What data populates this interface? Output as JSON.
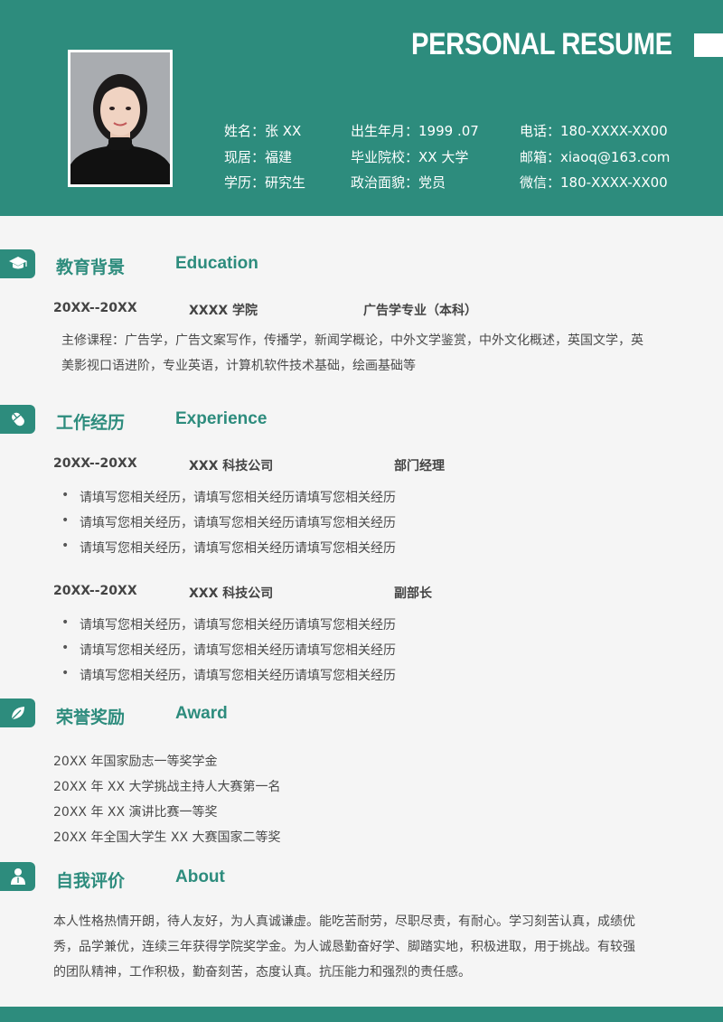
{
  "header": {
    "title": "PERSONAL RESUME",
    "accent_color": "#2d8c7d"
  },
  "profile": {
    "name": "姓名：张 XX",
    "location": "现居：福建",
    "degree": "学历：研究生",
    "birth": "出生年月：1999 .07",
    "school": "毕业院校：XX 大学",
    "politics": "政治面貌：党员",
    "phone": "电话：180-XXXX-XX00",
    "email": "邮箱：xiaoq@163.com",
    "wechat": "微信：180-XXXX-XX00"
  },
  "education": {
    "title_cn": "教育背景",
    "title_en": "Education",
    "icon": "graduation-cap-icon",
    "period": "20XX--20XX",
    "school": "XXXX 学院",
    "major": "广告学专业（本科）",
    "courses_line1": "主修课程：广告学，广告文案写作，传播学，新闻学概论，中外文学鉴赏，中外文化概述，英国文学，英",
    "courses_line2": "美影视口语进阶，专业英语，计算机软件技术基础，绘画基础等"
  },
  "experience": {
    "title_cn": "工作经历",
    "title_en": "Experience",
    "icon": "mouse-icon",
    "jobs": [
      {
        "period": "20XX--20XX",
        "company": "XXX 科技公司",
        "role": "部门经理",
        "items": [
          "请填写您相关经历，请填写您相关经历请填写您相关经历",
          "请填写您相关经历，请填写您相关经历请填写您相关经历",
          "请填写您相关经历，请填写您相关经历请填写您相关经历"
        ]
      },
      {
        "period": "20XX--20XX",
        "company": "XXX 科技公司",
        "role": "副部长",
        "items": [
          "请填写您相关经历，请填写您相关经历请填写您相关经历",
          "请填写您相关经历，请填写您相关经历请填写您相关经历",
          "请填写您相关经历，请填写您相关经历请填写您相关经历"
        ]
      }
    ]
  },
  "award": {
    "title_cn": "荣誉奖励",
    "title_en": "Award",
    "icon": "leaf-icon",
    "items": [
      "20XX 年国家励志一等奖学金",
      "20XX 年 XX 大学挑战主持人大赛第一名",
      "20XX 年 XX 演讲比赛一等奖",
      "20XX 年全国大学生 XX 大赛国家二等奖"
    ]
  },
  "about": {
    "title_cn": "自我评价",
    "title_en": "About",
    "icon": "person-icon",
    "line1": "本人性格热情开朗，待人友好，为人真诚谦虚。能吃苦耐劳，尽职尽责，有耐心。学习刻苦认真，成绩优",
    "line2": "秀，品学兼优，连续三年获得学院奖学金。为人诚恳勤奋好学、脚踏实地，积极进取，用于挑战。有较强",
    "line3": "的团队精神，工作积极，勤奋刻苦，态度认真。抗压能力和强烈的责任感。"
  }
}
